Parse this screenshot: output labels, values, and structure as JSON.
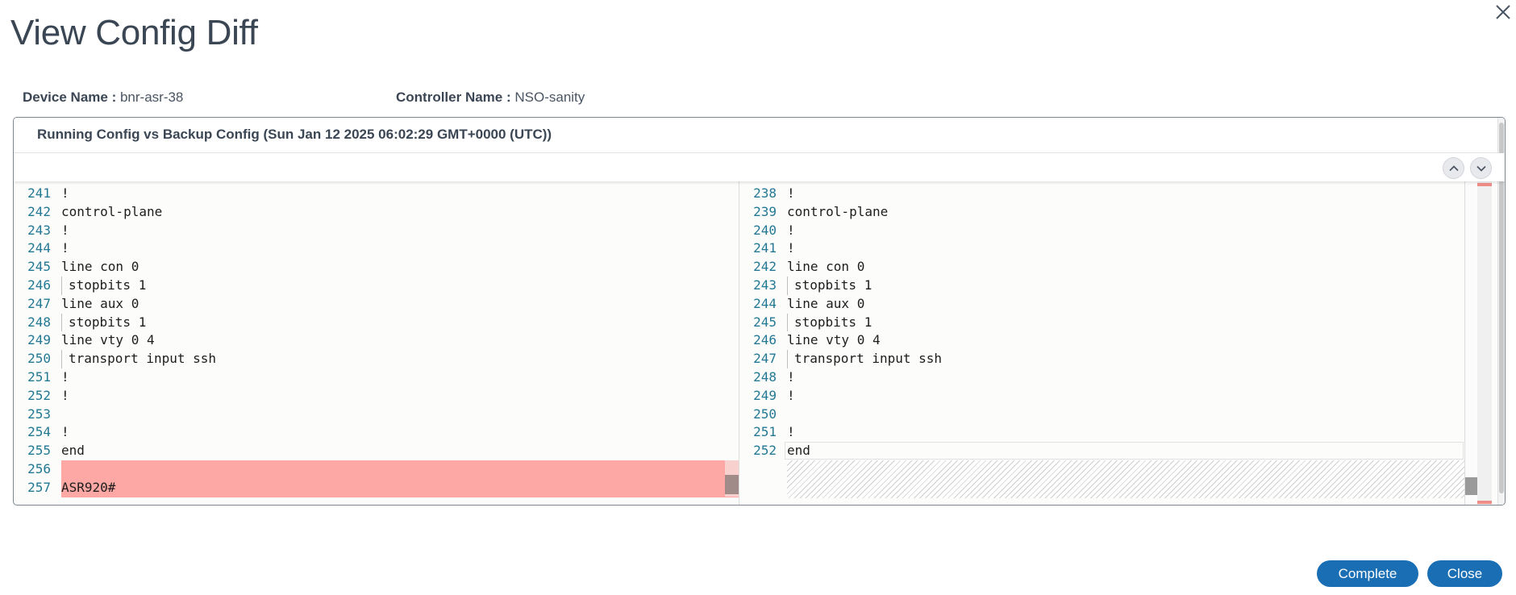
{
  "dialog": {
    "title": "View Config Diff",
    "close_icon": "close-icon"
  },
  "meta": {
    "device_label": "Device Name :",
    "device_value": "bnr-asr-38",
    "controller_label": "Controller Name :",
    "controller_value": "NSO-sanity"
  },
  "panel": {
    "title": "Running Config vs Backup Config (Sun Jan 12 2025 06:02:29 GMT+0000 (UTC))",
    "prev_icon": "chevron-up-icon",
    "next_icon": "chevron-down-icon"
  },
  "left_pane": {
    "lines": [
      {
        "num": "241",
        "text": "!"
      },
      {
        "num": "242",
        "text": "control-plane"
      },
      {
        "num": "243",
        "text": "!"
      },
      {
        "num": "244",
        "text": "!"
      },
      {
        "num": "245",
        "text": "line con 0"
      },
      {
        "num": "246",
        "text": "stopbits 1"
      },
      {
        "num": "247",
        "text": "line aux 0"
      },
      {
        "num": "248",
        "text": "stopbits 1"
      },
      {
        "num": "249",
        "text": "line vty 0 4"
      },
      {
        "num": "250",
        "text": "transport input ssh"
      },
      {
        "num": "251",
        "text": "!"
      },
      {
        "num": "252",
        "text": "!"
      },
      {
        "num": "253",
        "text": ""
      },
      {
        "num": "254",
        "text": "!"
      },
      {
        "num": "255",
        "text": "end"
      },
      {
        "num": "256",
        "text": ""
      },
      {
        "num": "257",
        "text": "ASR920#"
      }
    ]
  },
  "right_pane": {
    "lines": [
      {
        "num": "238",
        "text": "!"
      },
      {
        "num": "239",
        "text": "control-plane"
      },
      {
        "num": "240",
        "text": "!"
      },
      {
        "num": "241",
        "text": "!"
      },
      {
        "num": "242",
        "text": "line con 0"
      },
      {
        "num": "243",
        "text": "stopbits 1"
      },
      {
        "num": "244",
        "text": "line aux 0"
      },
      {
        "num": "245",
        "text": "stopbits 1"
      },
      {
        "num": "246",
        "text": "line vty 0 4"
      },
      {
        "num": "247",
        "text": "transport input ssh"
      },
      {
        "num": "248",
        "text": "!"
      },
      {
        "num": "249",
        "text": "!"
      },
      {
        "num": "250",
        "text": ""
      },
      {
        "num": "251",
        "text": "!"
      },
      {
        "num": "252",
        "text": "end"
      }
    ]
  },
  "buttons": {
    "complete": "Complete",
    "close": "Close"
  },
  "colors": {
    "accent": "#1a6eb4",
    "removed": "#fda8a4",
    "line_number": "#237893"
  }
}
